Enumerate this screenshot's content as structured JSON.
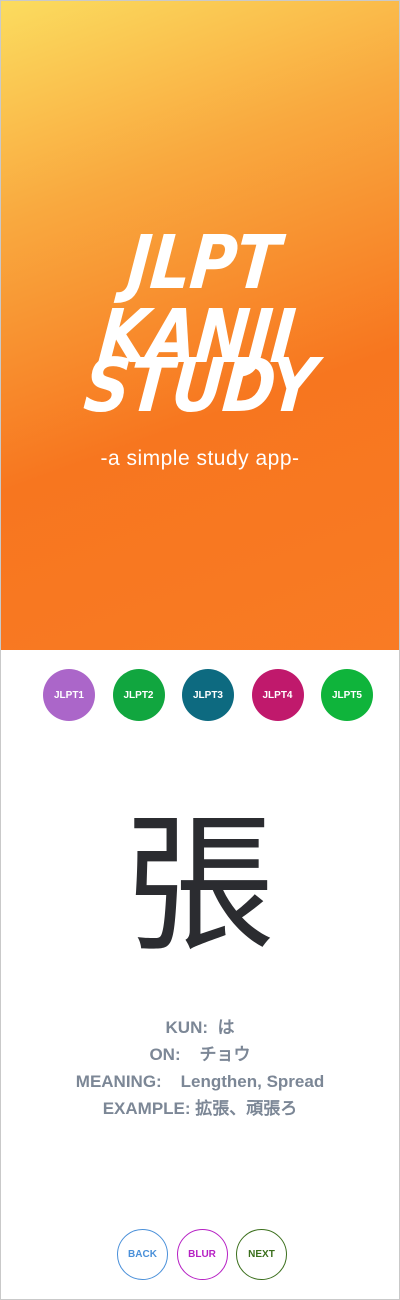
{
  "hero": {
    "title_line1": "JLPT KANJI",
    "title_line2": "STUDY",
    "subtitle": "-a simple study app-"
  },
  "levels": [
    {
      "label": "JLPT1",
      "color": "#ab66c9"
    },
    {
      "label": "JLPT2",
      "color": "#11a63f"
    },
    {
      "label": "JLPT3",
      "color": "#0d6a80"
    },
    {
      "label": "JLPT4",
      "color": "#c0196c"
    },
    {
      "label": "JLPT5",
      "color": "#0fb43b"
    }
  ],
  "card": {
    "kanji": "張",
    "kun_label": "KUN:",
    "kun_value": "は",
    "on_label": "ON:",
    "on_value": "チョウ",
    "meaning_label": "MEANING:",
    "meaning_value": "Lengthen, Spread",
    "example_label": "EXAMPLE:",
    "example_value": "拡張、頑張ろ"
  },
  "controls": {
    "back": {
      "label": "BACK",
      "color": "#4a90d9"
    },
    "blur": {
      "label": "BLUR",
      "color": "#b620c4"
    },
    "next": {
      "label": "NEXT",
      "color": "#3b6f1c"
    }
  }
}
